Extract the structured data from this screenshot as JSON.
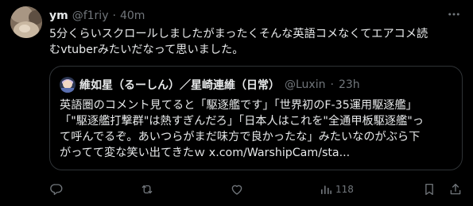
{
  "post": {
    "author_name": "ym",
    "handle": "@f1riy",
    "separator": "·",
    "time": "40m",
    "text_lines": [
      "5分くらいスクロールしましたがまったくそんな英語コメなくてエアコメ読",
      "むvtuberみたいだなって思いました。"
    ]
  },
  "quote": {
    "author_name": "維如星（るーしん）／星崎連維（日常）",
    "handle": "@Luxin",
    "separator": "·",
    "time": "23h",
    "text_lines": [
      "英語圏のコメント見てると「駆逐艦です」「世界初のF-35運用駆逐艦」",
      "「\"駆逐艦打撃群\"は熱すぎんだろ」「日本人はこれを\"全通甲板駆逐艦\"っ",
      "て呼んでるぞ。あいつらがまだ味方で良かったな」みたいなのがぶら下",
      "がってて変な笑い出てきたｗ x.com/WarshipCam/sta..."
    ]
  },
  "actions": {
    "views_count": "118"
  },
  "icons": {
    "more": "more-horizontal-icon",
    "reply": "reply-icon",
    "repost": "repost-icon",
    "like": "like-icon",
    "views": "views-icon",
    "bookmark": "bookmark-icon",
    "share": "share-icon"
  },
  "colors": {
    "background": "#000000",
    "text_primary": "#e7e9ea",
    "text_secondary": "#71767b",
    "border": "#2f3336"
  }
}
